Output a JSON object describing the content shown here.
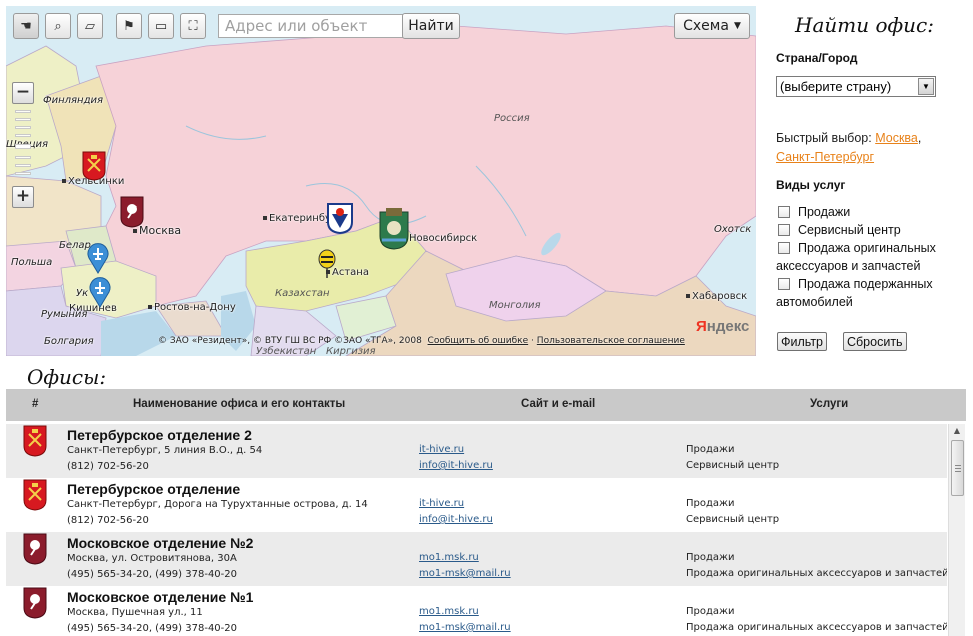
{
  "map": {
    "search_placeholder": "Адрес или объект",
    "find_label": "Найти",
    "layer_label": "Схема",
    "tools": [
      "hand-icon",
      "magnifier-icon",
      "ruler-icon",
      "flag-icon",
      "layer-icon",
      "fullscreen-icon"
    ],
    "zoom_in": "+",
    "zoom_out": "−",
    "cities": {
      "finland": "Финляндия",
      "sweden": "Швеция",
      "helsinki": "Хельсинки",
      "moscow": "Москва",
      "yekaterinburg": "Екатеринбург",
      "novosibirsk": "Новосибирск",
      "astana": "Астана",
      "belarus": "Белар",
      "poland": "Польша",
      "ukraine": "Ук",
      "kishinev": "Кишинев",
      "romania": "Румыния",
      "bulgaria": "Болгария",
      "rostov": "Ростов-на-Дону",
      "khabarovsk": "Хабаровск",
      "okhotsk": "Охотск"
    },
    "regions": {
      "russia": "Россия",
      "kazakhstan": "Казахстан",
      "mongolia": "Монголия",
      "uzbekistan": "Узбекистан",
      "kirgizia": "Киргизия"
    },
    "attribution": "© ЗАО «Резидент», © ВТУ ГШ ВС РФ ©ЗАО «ТГА», 2008",
    "report_error": "Сообщить об ошибке",
    "separator": "·",
    "user_agreement": "Пользовательское соглашение",
    "logo_first": "Я",
    "logo_rest": "ндекс"
  },
  "sidebar": {
    "title": "Найти офис:",
    "country_label": "Страна/Город",
    "country_select": "(выберите страну)",
    "quick_label": "Быстрый выбор:",
    "quick_moscow": "Москва",
    "quick_comma": ",",
    "quick_spb": "Санкт-Петербург",
    "services_label": "Виды услуг",
    "services": [
      "Продажи",
      "Сервисный центр",
      "Продажа оригинальных аксессуаров и запчастей",
      "Продажа подержанных автомобилей"
    ],
    "filter_button": "Фильтр",
    "reset_button": "Сбросить"
  },
  "offices": {
    "title": "Офисы:",
    "columns": [
      "#",
      "Наименование офиса и его контакты",
      "Сайт и e-mail",
      "Услуги"
    ],
    "rows": [
      {
        "emblem": "spb-emblem-icon",
        "name": "Петербурское отделение 2",
        "address": "Санкт-Петербург, 5 линия В.О., д. 54",
        "phone": "(812) 702-56-20",
        "site": "it-hive.ru",
        "email": "info@it-hive.ru",
        "services": [
          "Продажи",
          "Сервисный центр"
        ]
      },
      {
        "emblem": "spb-emblem-icon",
        "name": "Петербурское отделение",
        "address": "Санкт-Петербург, Дорога на Турухтанные острова, д. 14",
        "phone": "(812) 702-56-20",
        "site": "it-hive.ru",
        "email": "info@it-hive.ru",
        "services": [
          "Продажи",
          "Сервисный центр"
        ]
      },
      {
        "emblem": "moscow-emblem-icon",
        "name": "Московское отделение №2",
        "address": "Москва, ул. Островитянова, 30А",
        "phone": "(495) 565-34-20, (499) 378-40-20",
        "site": "mo1.msk.ru",
        "email": "mo1-msk@mail.ru",
        "services": [
          "Продажи",
          "Продажа оригинальных аксессуаров и запчастей"
        ]
      },
      {
        "emblem": "moscow-emblem-icon",
        "name": "Московское отделение №1",
        "address": "Москва, Пушечная ул., 11",
        "phone": "(495) 565-34-20, (499) 378-40-20",
        "site": "mo1.msk.ru",
        "email": "mo1-msk@mail.ru",
        "services": [
          "Продажи",
          "Продажа оригинальных аксессуаров и запчастей"
        ]
      }
    ]
  },
  "colors": {
    "link_orange": "#e8821a",
    "link_blue": "#2a5a8a",
    "header_gray": "#c9c9c9",
    "russia_pink": "#f6d2d8",
    "kazakhstan_yellow": "#e9ecaa",
    "sea_blue": "#d8ecf4"
  }
}
